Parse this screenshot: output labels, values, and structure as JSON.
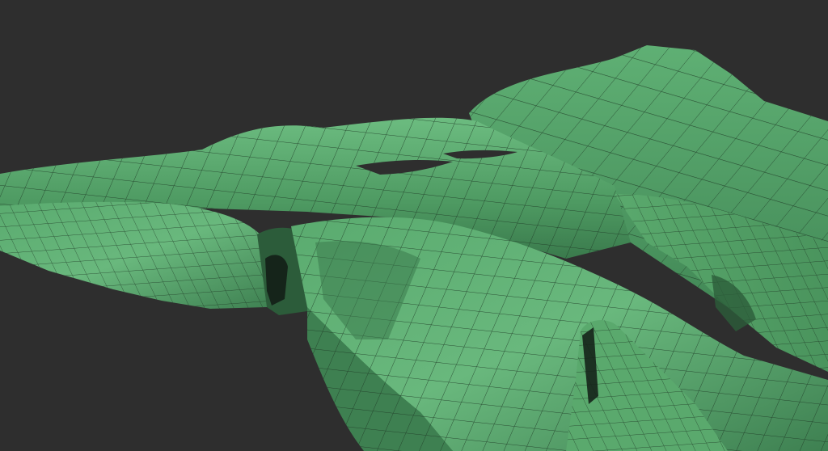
{
  "viewport": {
    "background_color": "#2e2e2e",
    "mesh": {
      "shape": "sculpted green polygon mesh with wireframe",
      "base_color": "#4e9a62",
      "highlight_color": "#6cbc80",
      "shadow_color": "#2c5c3a",
      "deep_shadow_color": "#15241a",
      "wire_color": "#1f3a26"
    }
  }
}
